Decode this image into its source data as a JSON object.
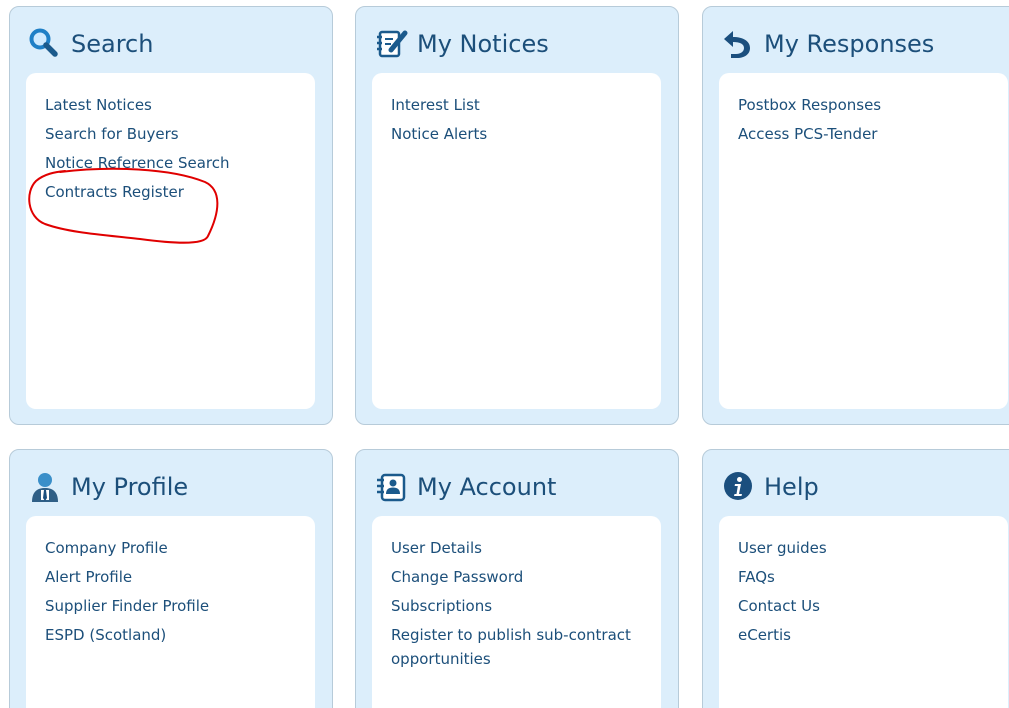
{
  "panels": {
    "search": {
      "title": "Search",
      "icon": "search-icon",
      "links": [
        "Latest Notices",
        "Search for Buyers",
        "Notice Reference Search",
        "Contracts Register"
      ]
    },
    "notices": {
      "title": "My Notices",
      "icon": "notepad-pencil-icon",
      "links": [
        "Interest List",
        "Notice Alerts"
      ]
    },
    "responses": {
      "title": "My Responses",
      "icon": "reply-arrow-icon",
      "links": [
        "Postbox Responses",
        "Access PCS-Tender"
      ]
    },
    "profile": {
      "title": "My Profile",
      "icon": "user-profile-icon",
      "links": [
        "Company Profile",
        "Alert Profile",
        "Supplier Finder Profile",
        "ESPD (Scotland)"
      ]
    },
    "account": {
      "title": "My Account",
      "icon": "address-book-icon",
      "links": [
        "User Details",
        "Change Password",
        "Subscriptions",
        "Register to publish sub-contract opportunities"
      ]
    },
    "help": {
      "title": "Help",
      "icon": "info-icon",
      "links": [
        "User guides",
        "FAQs",
        "Contact Us",
        "eCertis"
      ]
    }
  },
  "colors": {
    "panel_bg": "#dceefb",
    "panel_border": "#b7cbd9",
    "title_text": "#1c4f7a",
    "link_text": "#1c4f7a",
    "annotation_red": "#e00000"
  }
}
